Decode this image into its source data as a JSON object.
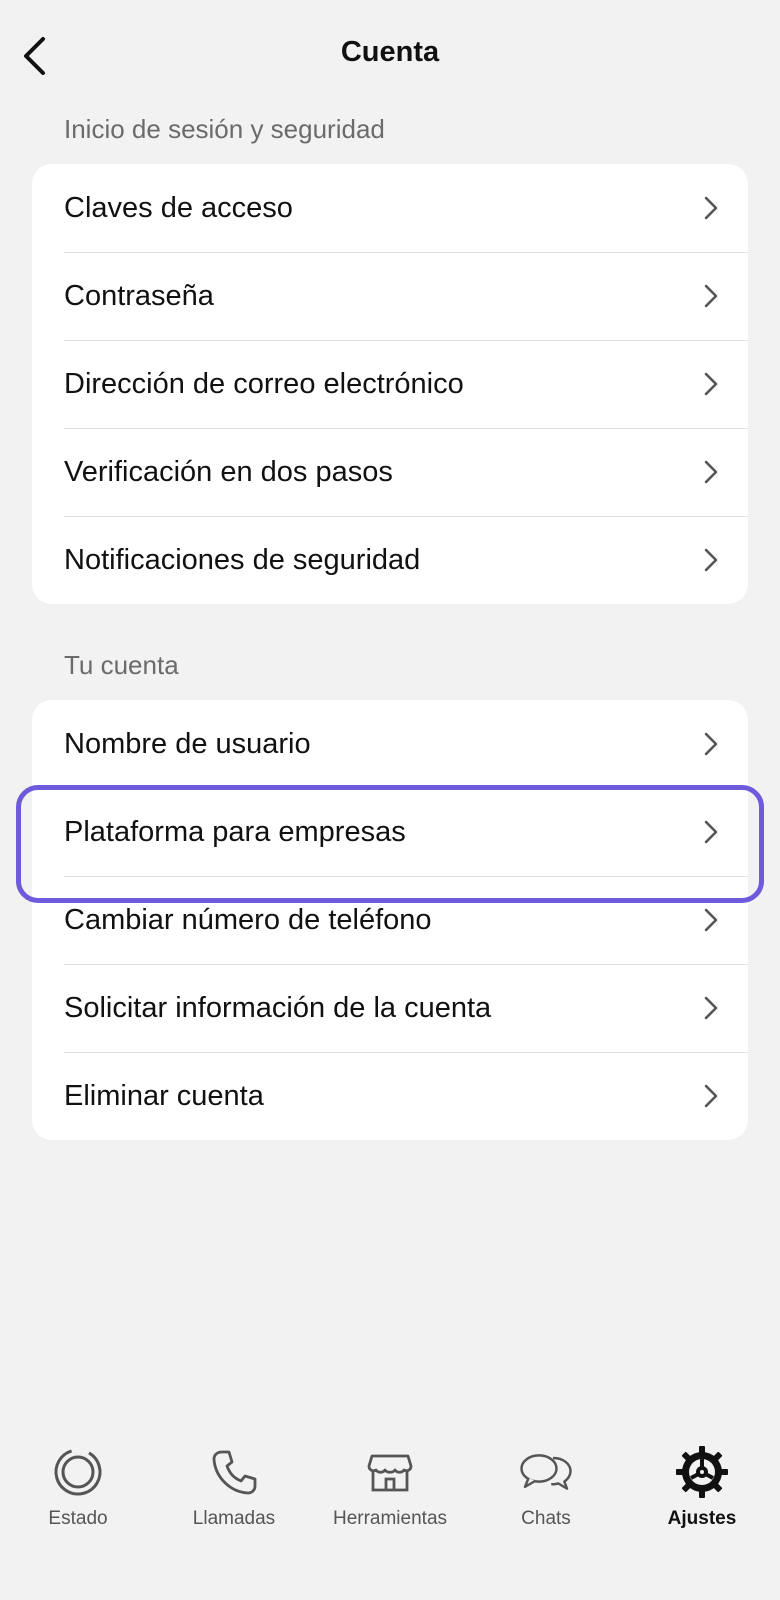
{
  "header": {
    "title": "Cuenta",
    "back_icon": "chevron-left-icon"
  },
  "sections": [
    {
      "label": "Inicio de sesión y seguridad",
      "items": [
        {
          "label": "Claves de acceso"
        },
        {
          "label": "Contraseña"
        },
        {
          "label": "Dirección de correo electrónico"
        },
        {
          "label": "Verificación en dos pasos"
        },
        {
          "label": "Notificaciones de seguridad"
        }
      ]
    },
    {
      "label": "Tu cuenta",
      "items": [
        {
          "label": "Nombre de usuario"
        },
        {
          "label": "Plataforma para empresas",
          "highlighted": true
        },
        {
          "label": "Cambiar número de teléfono"
        },
        {
          "label": "Solicitar información de la cuenta"
        },
        {
          "label": "Eliminar cuenta"
        }
      ]
    }
  ],
  "tabbar": {
    "tabs": [
      {
        "label": "Estado",
        "icon": "status-icon"
      },
      {
        "label": "Llamadas",
        "icon": "phone-icon"
      },
      {
        "label": "Herramientas",
        "icon": "store-icon"
      },
      {
        "label": "Chats",
        "icon": "chat-bubbles-icon"
      },
      {
        "label": "Ajustes",
        "icon": "gear-icon",
        "active": true
      }
    ]
  },
  "colors": {
    "background": "#f2f2f2",
    "card": "#ffffff",
    "highlight": "#6e5bdc",
    "section_label": "#6b6b6b"
  }
}
